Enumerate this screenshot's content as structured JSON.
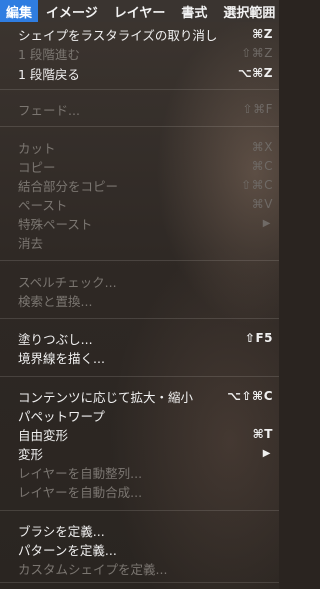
{
  "menubar": {
    "items": [
      {
        "label": "編集",
        "active": true
      },
      {
        "label": "イメージ"
      },
      {
        "label": "レイヤー"
      },
      {
        "label": "書式"
      },
      {
        "label": "選択範囲"
      }
    ]
  },
  "menu": {
    "items": [
      {
        "label": "シェイプをラスタライズの取り消し",
        "shortcut": "⌘Z",
        "enabled": true
      },
      {
        "label": "1 段階進む",
        "shortcut": "⇧⌘Z",
        "enabled": false
      },
      {
        "label": "1 段階戻る",
        "shortcut": "⌥⌘Z",
        "enabled": true
      },
      {
        "label": "フェード...",
        "shortcut": "⇧⌘F",
        "enabled": false
      },
      {
        "label": "カット",
        "shortcut": "⌘X",
        "enabled": false
      },
      {
        "label": "コピー",
        "shortcut": "⌘C",
        "enabled": false
      },
      {
        "label": "結合部分をコピー",
        "shortcut": "⇧⌘C",
        "enabled": false
      },
      {
        "label": "ペースト",
        "shortcut": "⌘V",
        "enabled": false
      },
      {
        "label": "特殊ペースト",
        "shortcut": "▶",
        "enabled": false
      },
      {
        "label": "消去",
        "shortcut": "",
        "enabled": false
      },
      {
        "label": "スペルチェック...",
        "shortcut": "",
        "enabled": false
      },
      {
        "label": "検索と置換...",
        "shortcut": "",
        "enabled": false
      },
      {
        "label": "塗りつぶし...",
        "shortcut": "⇧F5",
        "enabled": true
      },
      {
        "label": "境界線を描く...",
        "shortcut": "",
        "enabled": true
      },
      {
        "label": "コンテンツに応じて拡大・縮小",
        "shortcut": "⌥⇧⌘C",
        "enabled": true
      },
      {
        "label": "パペットワープ",
        "shortcut": "",
        "enabled": true
      },
      {
        "label": "自由変形",
        "shortcut": "⌘T",
        "enabled": true
      },
      {
        "label": "変形",
        "shortcut": "▶",
        "enabled": true
      },
      {
        "label": "レイヤーを自動整列...",
        "shortcut": "",
        "enabled": false
      },
      {
        "label": "レイヤーを自動合成...",
        "shortcut": "",
        "enabled": false
      },
      {
        "label": "ブラシを定義...",
        "shortcut": "",
        "enabled": true
      },
      {
        "label": "パターンを定義...",
        "shortcut": "",
        "enabled": true
      },
      {
        "label": "カスタムシェイプを定義...",
        "shortcut": "",
        "enabled": false
      }
    ]
  }
}
